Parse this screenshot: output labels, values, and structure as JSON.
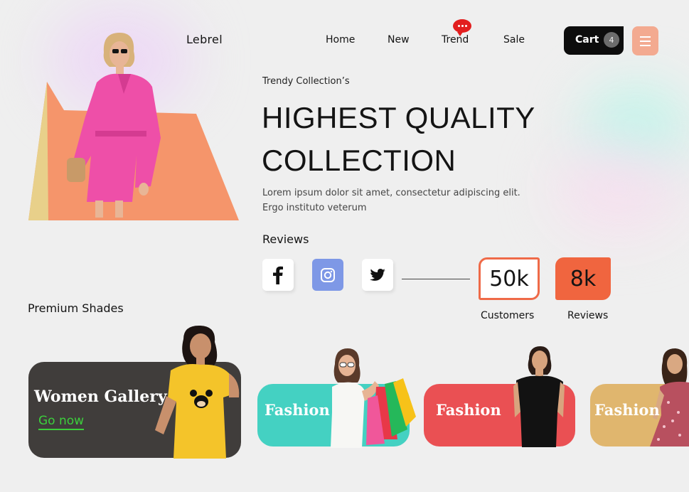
{
  "header": {
    "brand": "Lebrel",
    "nav": [
      "Home",
      "New",
      "Trend",
      "Sale"
    ],
    "cart_label": "Cart",
    "cart_count": "4"
  },
  "hero": {
    "kicker": "Trendy Collection’s",
    "headline_line1": "HIGHEST QUALITY",
    "headline_line2": "COLLECTION",
    "body": "Lorem ipsum dolor sit amet, consectetur adipiscing elit. Ergo instituto veterum",
    "reviews_heading": "Reviews"
  },
  "social": {
    "facebook": "f",
    "instagram": "instagram-icon",
    "twitter": "twitter-icon"
  },
  "stats": [
    {
      "value": "50k",
      "label": "Customers"
    },
    {
      "value": "8k",
      "label": "Reviews"
    }
  ],
  "section_title": "Premium Shades",
  "cards": {
    "women_title": "Women Gallery",
    "women_cta": "Go now",
    "fashion": [
      "Fashion",
      "Fashion",
      "Fashion"
    ]
  },
  "colors": {
    "background": "#efefef",
    "accent_orange": "#f0653f",
    "menu_button": "#f3aa90",
    "instagram": "#7e98e6",
    "card_dark": "#403d3b",
    "card_teal": "#44d1c2",
    "card_red": "#ea5053",
    "card_tan": "#e0b66e",
    "cta_green": "#3ccf3c"
  }
}
